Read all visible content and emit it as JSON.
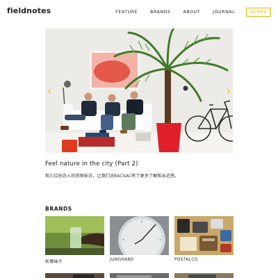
{
  "header": {
    "logo": "fieldnotes",
    "nav": [
      "FEATURE",
      "BRANDS",
      "ABOUT",
      "JOURNAL"
    ],
    "store_label": "STORE",
    "accent_color": "#e8b400"
  },
  "hero": {
    "arrow_left": "‹",
    "arrow_right": "›",
    "slide_count": 4,
    "active_slide": 1
  },
  "article": {
    "title": "Feel nature in the city (Part 2)",
    "description": "和三位创办人的视频采访，让我们对BACSAC有了更多了解和亲近感。"
  },
  "brands": {
    "heading": "BRANDS",
    "items": [
      {
        "label": "松德硝子"
      },
      {
        "label": "JUNGHANS"
      },
      {
        "label": "POSTALCO"
      }
    ]
  }
}
